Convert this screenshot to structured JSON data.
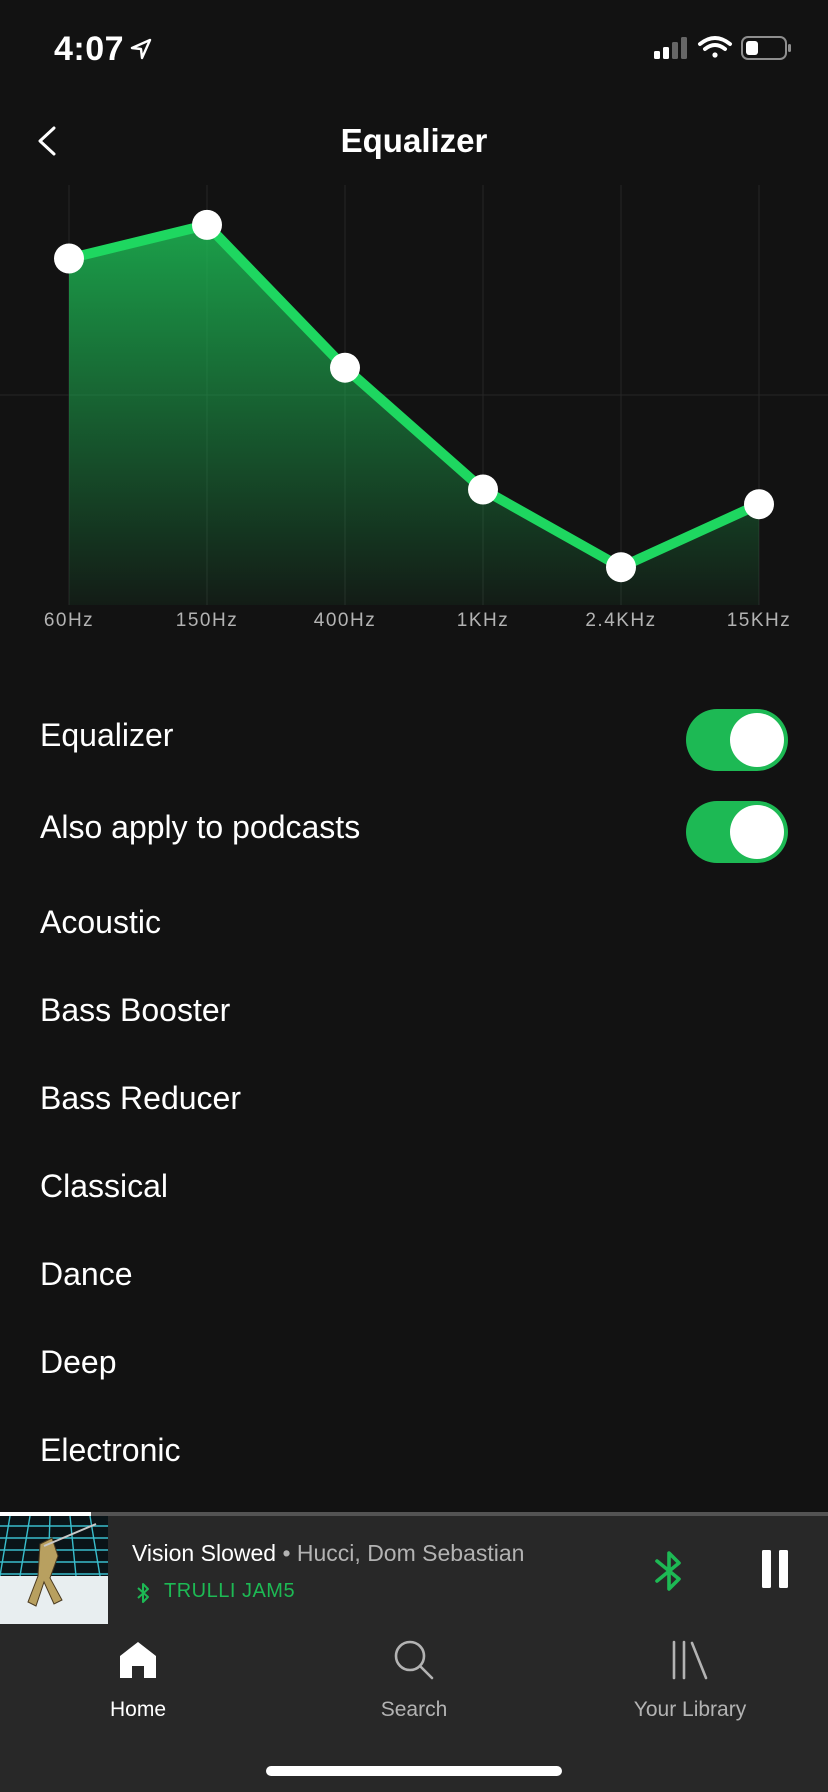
{
  "status_bar": {
    "time": "4:07",
    "location_icon": "location-arrow-icon",
    "signal_icon": "cellular-signal-icon",
    "wifi_icon": "wifi-icon",
    "battery_icon": "battery-icon"
  },
  "header": {
    "title": "Equalizer",
    "back_icon": "chevron-left-icon"
  },
  "chart_data": {
    "type": "line",
    "categories": [
      "60Hz",
      "150Hz",
      "400Hz",
      "1KHz",
      "2.4KHz",
      "15KHz"
    ],
    "values": [
      0.65,
      0.81,
      0.13,
      -0.45,
      -0.82,
      -0.52
    ],
    "ylim": [
      -1,
      1
    ],
    "grid": true,
    "line_color": "#1ed760",
    "fill_color": "#1db954"
  },
  "settings": {
    "equalizer_toggle": {
      "label": "Equalizer",
      "on": true
    },
    "podcasts_toggle": {
      "label": "Also apply to podcasts",
      "on": true
    }
  },
  "presets": [
    "Acoustic",
    "Bass Booster",
    "Bass Reducer",
    "Classical",
    "Dance",
    "Deep",
    "Electronic"
  ],
  "mini_player": {
    "title": "Vision Slowed",
    "separator": " • ",
    "artist": "Hucci, Dom Sebastian",
    "device": "TRULLI JAM5",
    "progress": 0.11,
    "connect_icon": "bluetooth-icon",
    "pause_icon": "pause-icon"
  },
  "tabs": [
    {
      "label": "Home",
      "icon": "home-icon",
      "active": true
    },
    {
      "label": "Search",
      "icon": "search-icon",
      "active": false
    },
    {
      "label": "Your Library",
      "icon": "library-icon",
      "active": false
    }
  ],
  "colors": {
    "background": "#121212",
    "accent": "#1db954",
    "player_background": "#282828"
  }
}
